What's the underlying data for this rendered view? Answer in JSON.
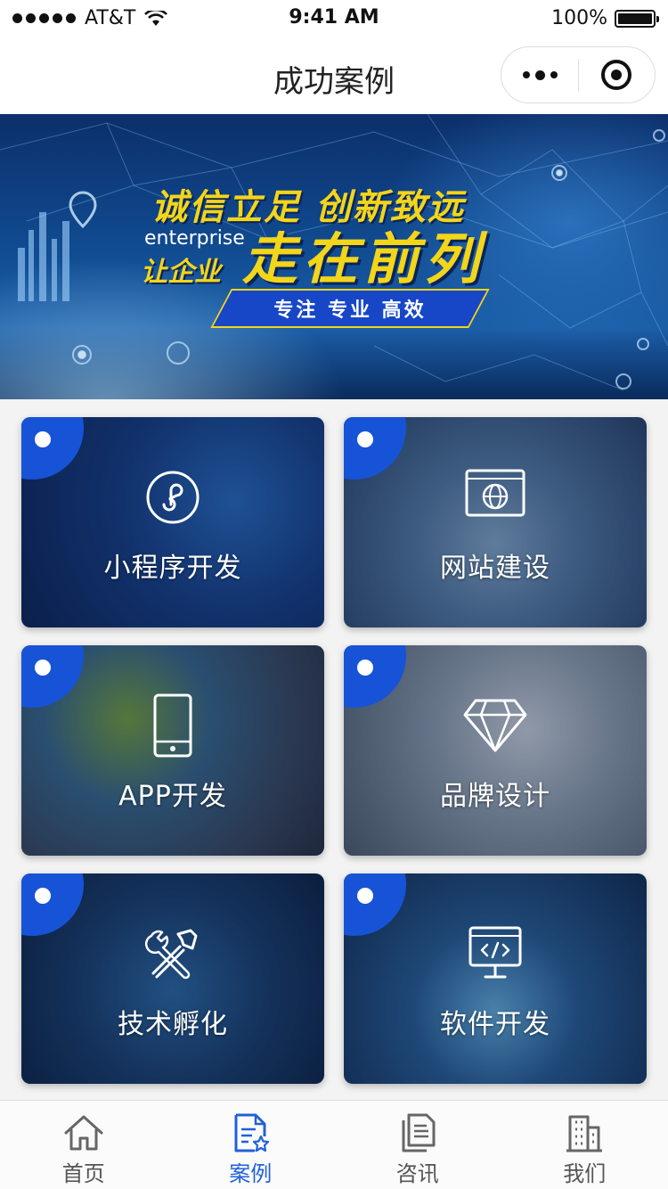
{
  "status_bar": {
    "carrier": "AT&T",
    "time": "9:41 AM",
    "battery": "100%"
  },
  "nav": {
    "title": "成功案例"
  },
  "banner": {
    "headline": "诚信立足 创新致远",
    "english": "enterprise",
    "sub_prefix": "让企业",
    "sub_main": "走在前列",
    "slogan": "专注 专业 高效"
  },
  "cards": [
    {
      "label": "小程序开发",
      "icon": "mini-program-icon"
    },
    {
      "label": "网站建设",
      "icon": "globe-browser-icon"
    },
    {
      "label": "APP开发",
      "icon": "smartphone-icon"
    },
    {
      "label": "品牌设计",
      "icon": "diamond-icon"
    },
    {
      "label": "技术孵化",
      "icon": "tools-icon"
    },
    {
      "label": "软件开发",
      "icon": "code-monitor-icon"
    }
  ],
  "tabs": [
    {
      "label": "首页",
      "icon": "home-icon",
      "active": false
    },
    {
      "label": "案例",
      "icon": "document-star-icon",
      "active": true
    },
    {
      "label": "咨讯",
      "icon": "news-icon",
      "active": false
    },
    {
      "label": "我们",
      "icon": "building-icon",
      "active": false
    }
  ],
  "colors": {
    "accent": "#2160d8",
    "banner_text": "#f3d51a",
    "corner_badge": "#1753d6"
  }
}
